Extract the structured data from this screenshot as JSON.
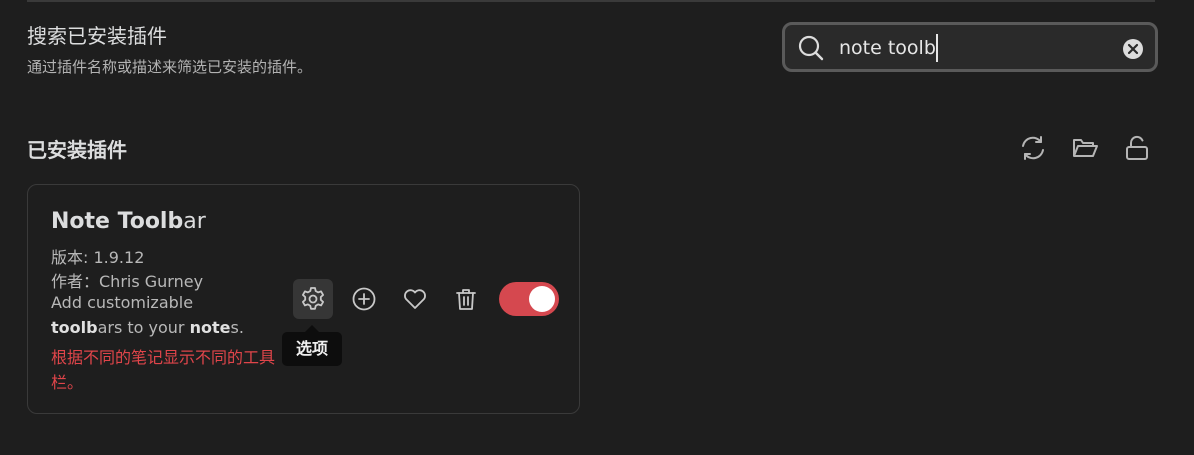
{
  "setting": {
    "title": "搜索已安装插件",
    "description": "通过插件名称或描述来筛选已安装的插件。"
  },
  "search": {
    "value": "note toolb",
    "clear_icon": "clear-circle-icon",
    "search_icon": "magnifier-icon"
  },
  "section": {
    "heading": "已安装插件",
    "actions": [
      "refresh-icon",
      "folder-open-icon",
      "unlock-icon"
    ]
  },
  "plugin": {
    "name_bold": "Note Toolb",
    "name_rest": "ar",
    "version": "版本: 1.9.12",
    "author": "作者：Chris Gurney",
    "desc_1": "Add customizable",
    "desc_bold_1": "toolb",
    "desc_2": "ars to your ",
    "desc_bold_2": "note",
    "desc_3": "s.",
    "warning": "根据不同的笔记显示不同的工具栏。",
    "enabled": true,
    "toggle_color": "#d5484f"
  },
  "tooltip": {
    "text": "选项"
  }
}
